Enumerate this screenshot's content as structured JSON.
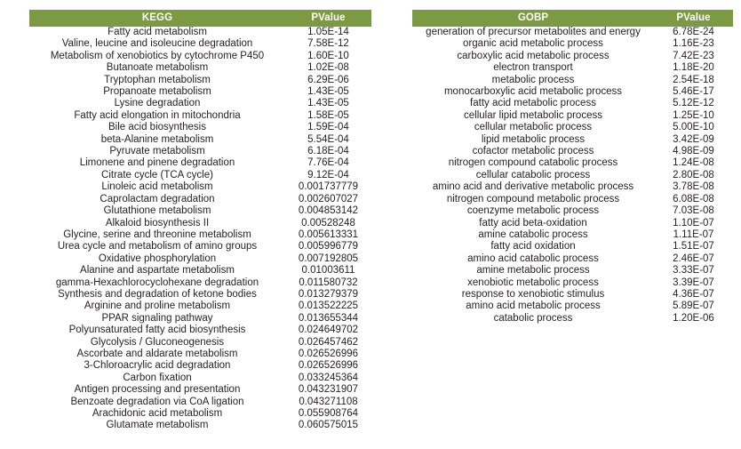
{
  "colors": {
    "header_green": "#7c9a41",
    "header_text": "#ffffff",
    "body_text": "#231f20",
    "background": "#ffffff"
  },
  "tables": {
    "kegg": {
      "columns": [
        "KEGG",
        "PValue"
      ],
      "rows": [
        [
          "Fatty acid metabolism",
          "1.05E-14"
        ],
        [
          "Valine, leucine and isoleucine degradation",
          "7.58E-12"
        ],
        [
          "Metabolism of xenobiotics by cytochrome P450",
          "1.60E-10"
        ],
        [
          "Butanoate metabolism",
          "1.02E-08"
        ],
        [
          "Tryptophan metabolism",
          "6.29E-06"
        ],
        [
          "Propanoate metabolism",
          "1.43E-05"
        ],
        [
          "Lysine degradation",
          "1.43E-05"
        ],
        [
          "Fatty acid elongation in mitochondria",
          "1.58E-05"
        ],
        [
          "Bile acid biosynthesis",
          "1.59E-04"
        ],
        [
          "beta-Alanine metabolism",
          "5.54E-04"
        ],
        [
          "Pyruvate metabolism",
          "6.18E-04"
        ],
        [
          "Limonene and pinene degradation",
          "7.76E-04"
        ],
        [
          "Citrate cycle (TCA cycle)",
          "9.12E-04"
        ],
        [
          "Linoleic acid metabolism",
          "0.001737779"
        ],
        [
          "Caprolactam degradation",
          "0.002607027"
        ],
        [
          "Glutathione metabolism",
          "0.004853142"
        ],
        [
          "Alkaloid biosynthesis II",
          "0.00528248"
        ],
        [
          "Glycine, serine and threonine metabolism",
          "0.005613331"
        ],
        [
          "Urea cycle and metabolism of amino groups",
          "0.005996779"
        ],
        [
          "Oxidative phosphorylation",
          "0.007192805"
        ],
        [
          "Alanine and aspartate metabolism",
          "0.01003611"
        ],
        [
          "gamma-Hexachlorocyclohexane degradation",
          "0.011580732"
        ],
        [
          "Synthesis and degradation of ketone bodies",
          "0.013279379"
        ],
        [
          "Arginine and proline metabolism",
          "0.013522225"
        ],
        [
          "PPAR signaling pathway",
          "0.013655344"
        ],
        [
          "Polyunsaturated fatty acid biosynthesis",
          "0.024649702"
        ],
        [
          "Glycolysis / Gluconeogenesis",
          "0.026457462"
        ],
        [
          "Ascorbate and aldarate metabolism",
          "0.026526996"
        ],
        [
          "3-Chloroacrylic acid degradation",
          "0.026526996"
        ],
        [
          "Carbon fixation",
          "0.033245364"
        ],
        [
          "Antigen processing and presentation",
          "0.043231907"
        ],
        [
          "Benzoate degradation via CoA ligation",
          "0.043271108"
        ],
        [
          "Arachidonic acid metabolism",
          "0.055908764"
        ],
        [
          "Glutamate metabolism",
          "0.060575015"
        ]
      ]
    },
    "gobp": {
      "columns": [
        "GOBP",
        "PValue"
      ],
      "rows": [
        [
          "generation of precursor metabolites and energy",
          "6.78E-24"
        ],
        [
          "organic acid metabolic process",
          "1.16E-23"
        ],
        [
          "carboxylic acid metabolic process",
          "7.42E-23"
        ],
        [
          "electron transport",
          "1.18E-20"
        ],
        [
          "metabolic process",
          "2.54E-18"
        ],
        [
          "monocarboxylic acid metabolic process",
          "5.46E-17"
        ],
        [
          "fatty acid metabolic process",
          "5.12E-12"
        ],
        [
          "cellular lipid metabolic process",
          "1.25E-10"
        ],
        [
          "cellular metabolic process",
          "5.00E-10"
        ],
        [
          "lipid metabolic process",
          "3.42E-09"
        ],
        [
          "cofactor metabolic process",
          "4.98E-09"
        ],
        [
          "nitrogen compound catabolic process",
          "1.24E-08"
        ],
        [
          "cellular catabolic process",
          "2.80E-08"
        ],
        [
          "amino acid and derivative metabolic process",
          "3.78E-08"
        ],
        [
          "nitrogen compound metabolic process",
          "6.08E-08"
        ],
        [
          "coenzyme metabolic process",
          "7.03E-08"
        ],
        [
          "fatty acid beta-oxidation",
          "1.10E-07"
        ],
        [
          "amine catabolic process",
          "1.11E-07"
        ],
        [
          "fatty acid oxidation",
          "1.51E-07"
        ],
        [
          "amino acid catabolic process",
          "2.46E-07"
        ],
        [
          "amine metabolic process",
          "3.33E-07"
        ],
        [
          "xenobiotic metabolic process",
          "3.39E-07"
        ],
        [
          "response to xenobiotic stimulus",
          "4.36E-07"
        ],
        [
          "amino acid metabolic process",
          "5.89E-07"
        ],
        [
          "catabolic process",
          "1.20E-06"
        ]
      ]
    }
  }
}
